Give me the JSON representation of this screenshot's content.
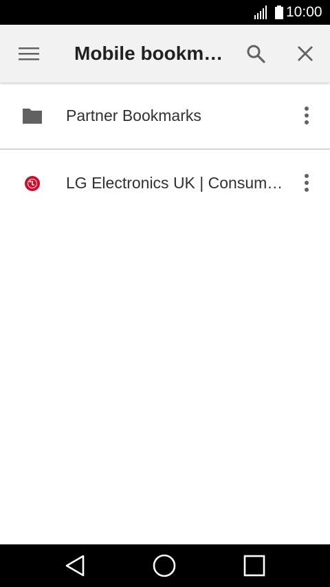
{
  "status_bar": {
    "time": "10:00",
    "icons": [
      "signal-icon",
      "battery-icon"
    ]
  },
  "toolbar": {
    "title": "Mobile bookm…",
    "icons": [
      "menu-icon",
      "search-icon",
      "close-icon"
    ]
  },
  "bookmarks": [
    {
      "label": "Partner Bookmarks",
      "icon": "folder-icon"
    },
    {
      "label": "LG Electronics UK | Consum…",
      "icon": "lg-favicon-icon"
    }
  ],
  "nav_bar": {
    "icons": [
      "back-icon",
      "home-icon",
      "recents-icon"
    ]
  },
  "colors": {
    "status_bar_bg": "#000000",
    "toolbar_bg": "#f2f2f2",
    "icon_gray": "#616161",
    "lg_red": "#c8102e"
  }
}
